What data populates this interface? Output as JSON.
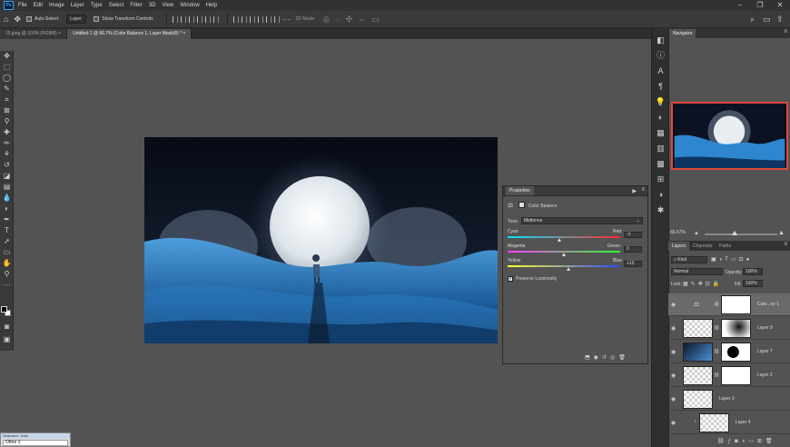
{
  "menubar": {
    "logo": "Ps",
    "items": [
      "File",
      "Edit",
      "Image",
      "Layer",
      "Type",
      "Select",
      "Filter",
      "3D",
      "View",
      "Window",
      "Help"
    ]
  },
  "options": {
    "auto_select_label": "Auto-Select:",
    "auto_select_value": "Layer",
    "transform_label": "Show Transform Controls",
    "mode_3d_label": "3D Mode:"
  },
  "tabs": [
    {
      "label": "15.jpeg @ 100% (RGB/8)",
      "active": false
    },
    {
      "label": "Untitled-1 @ 66.7% (Color Balance 1, Layer Mask/8) *",
      "active": true
    }
  ],
  "properties": {
    "tab": "Properties",
    "adj_name": "Color Balance",
    "tone_label": "Tone:",
    "tone_value": "Midtones",
    "sliders": [
      {
        "left": "Cyan",
        "right": "Red",
        "value": "-1",
        "frac": 0.46
      },
      {
        "left": "Magenta",
        "right": "Green",
        "value": "0",
        "frac": 0.5
      },
      {
        "left": "Yellow",
        "right": "Blue",
        "value": "+10",
        "frac": 0.54
      }
    ],
    "preserve_label": "Preserve Luminosity",
    "preserve_checked": true
  },
  "navigator": {
    "tab": "Navigator",
    "zoom": "66.67%"
  },
  "layers_panel": {
    "tabs": [
      "Layers",
      "Channels",
      "Paths"
    ],
    "kind_label": "Kind",
    "blend": "Normal",
    "opacity_label": "Opacity:",
    "opacity_value": "100%",
    "lock_label": "Lock:",
    "fill_label": "Fill:",
    "fill_value": "100%",
    "layers": [
      {
        "name": "Colo...ce 1",
        "kind": "adjustment",
        "selected": true
      },
      {
        "name": "Layer 9",
        "kind": "mask",
        "selected": false
      },
      {
        "name": "Layer 7",
        "kind": "image-mask",
        "selected": false
      },
      {
        "name": "Layer 2",
        "kind": "mask",
        "selected": false
      },
      {
        "name": "Layer 3",
        "kind": "plain",
        "selected": false
      },
      {
        "name": "Layer 4",
        "kind": "plain",
        "selected": false
      }
    ]
  },
  "status": {
    "title": "Selezione: Dasi",
    "value": "Ottne 2"
  },
  "colors": {
    "accent": "#31a8ff",
    "nav_border": "#e0493b",
    "panel_bg": "#535353",
    "dark_bg": "#323232"
  }
}
